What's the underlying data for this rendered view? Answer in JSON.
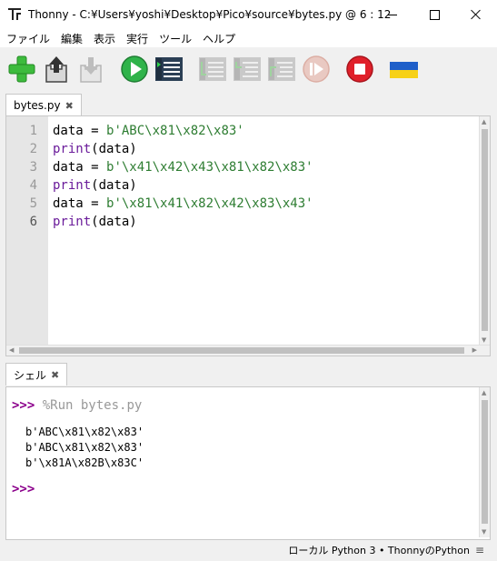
{
  "window": {
    "app_name": "Thonny",
    "title_rest": "  -  C:¥Users¥yoshi¥Desktop¥Pico¥source¥bytes.py  @  6 : 12"
  },
  "menu": [
    "ファイル",
    "編集",
    "表示",
    "実行",
    "ツール",
    "ヘルプ"
  ],
  "toolbar": {
    "icons": [
      "new-file",
      "open-file",
      "save-file",
      "run",
      "debug",
      "step-over",
      "step-into",
      "step-out",
      "resume",
      "stop",
      "ukraine-flag"
    ]
  },
  "editor": {
    "tab_label": "bytes.py",
    "line_numbers": [
      "1",
      "2",
      "3",
      "4",
      "5",
      "6"
    ],
    "lines": [
      {
        "a": "data = ",
        "s": "b'ABC\\x81\\x82\\x83'",
        "b": ""
      },
      {
        "k": "print",
        "a": "(data)"
      },
      {
        "a": "data = ",
        "s": "b'\\x41\\x42\\x43\\x81\\x82\\x83'",
        "b": ""
      },
      {
        "k": "print",
        "a": "(data)"
      },
      {
        "a": "data = ",
        "s": "b'\\x81\\x41\\x82\\x42\\x83\\x43'",
        "b": ""
      },
      {
        "k": "print",
        "a": "(data)"
      }
    ]
  },
  "shell": {
    "tab_label": "シェル",
    "prompt": ">>>",
    "command": " %Run bytes.py",
    "outputs": [
      "b'ABC\\x81\\x82\\x83'",
      "b'ABC\\x81\\x82\\x83'",
      "b'\\x81A\\x82B\\x83C'"
    ],
    "final_prompt": ">>>"
  },
  "status": {
    "interpreter": "ローカル Python 3  •  ThonnyのPython",
    "menu_glyph": "≡"
  },
  "colors": {
    "keyword": "#6a1b9a",
    "string": "#2e7d32",
    "prompt": "#8b008b",
    "run_green": "#2fb34a",
    "stop_red": "#e0202a"
  }
}
